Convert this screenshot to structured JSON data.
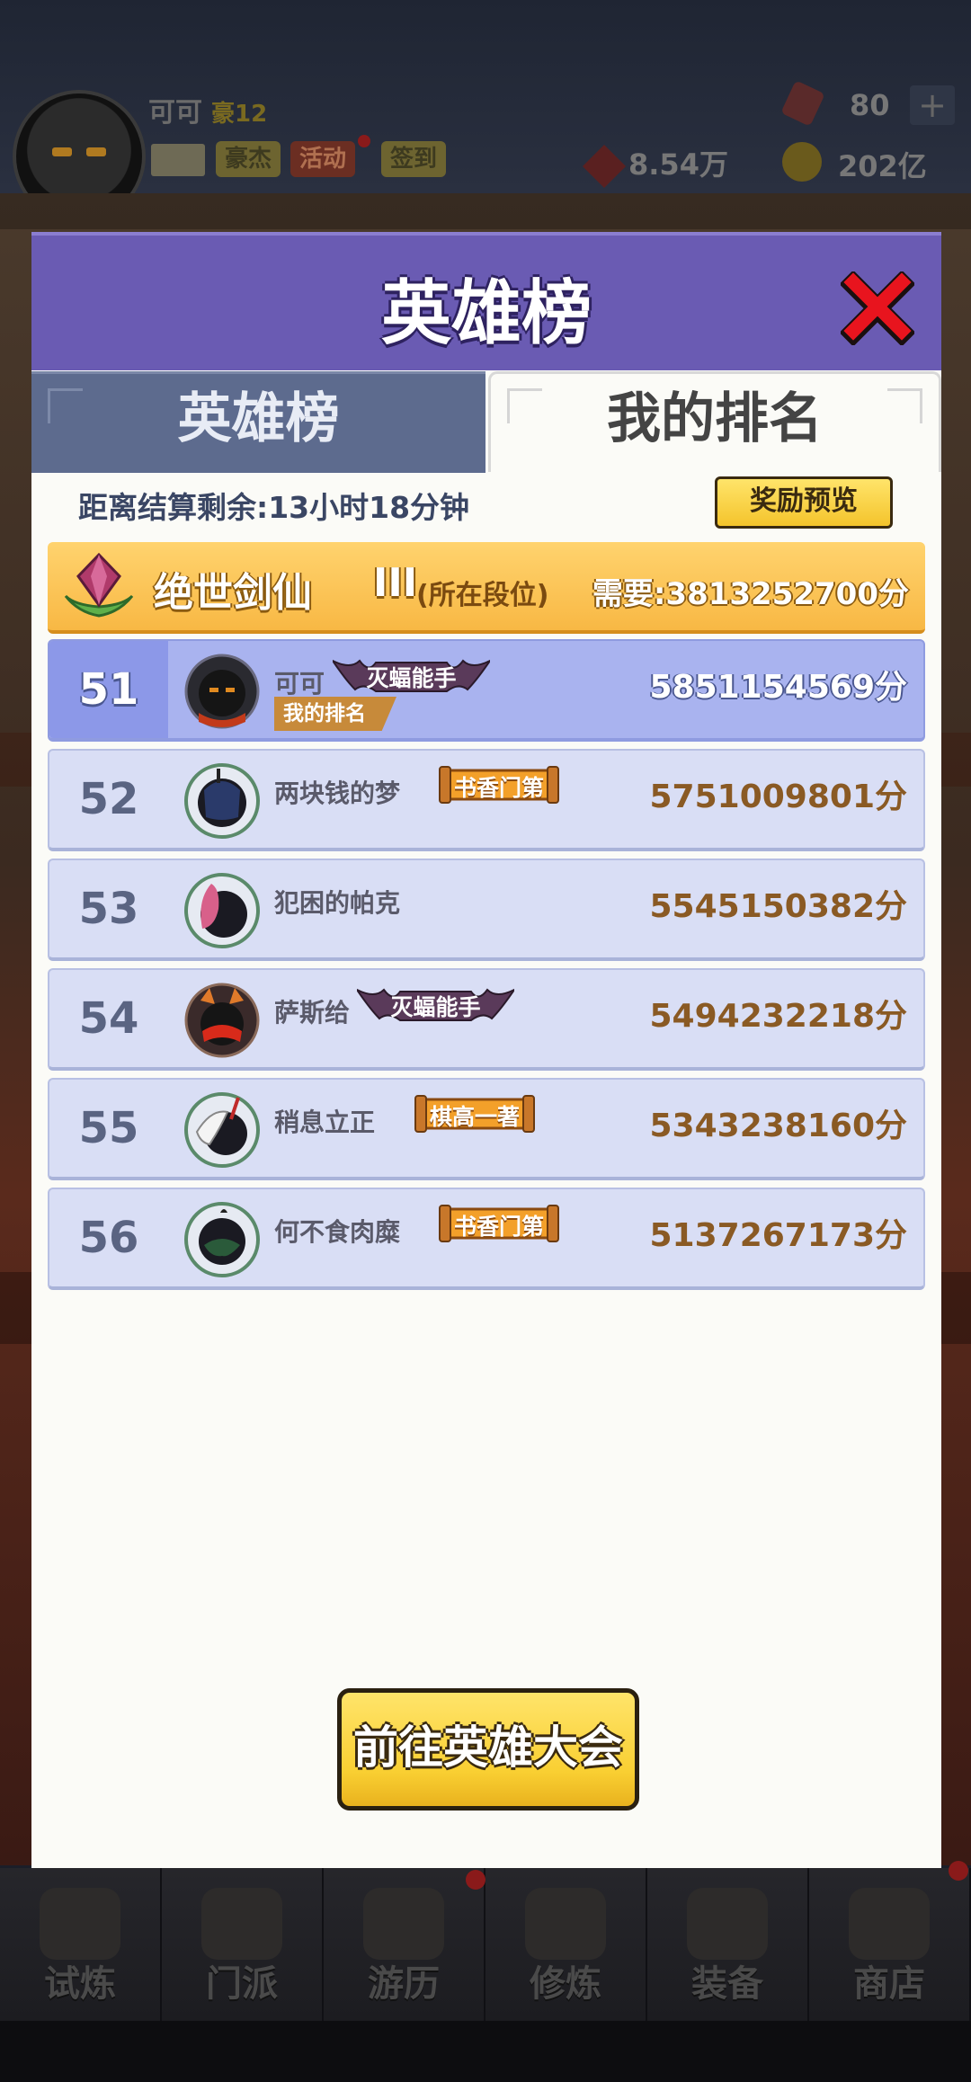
{
  "hud": {
    "player_name": "可可",
    "level": "豪12",
    "buttons": [
      "豪杰",
      "活动",
      "签到"
    ],
    "gems": "80",
    "power": "8.54万",
    "coins": "202亿"
  },
  "dialog": {
    "title": "英雄榜",
    "tabs": {
      "leaderboard": "英雄榜",
      "my_rank": "我的排名"
    },
    "countdown": "距离结算剩余:13小时18分钟",
    "reward_preview": "奖励预览",
    "tier": {
      "name": "绝世剑仙",
      "level": "III",
      "note": "(所在段位)",
      "requirement": "需要:3813252700分"
    },
    "my_rank_tag": "我的排名",
    "goto_button": "前往英雄大会"
  },
  "ranks": [
    {
      "rank": "51",
      "name": "可可",
      "badge": "灭蝠能手",
      "score": "5851154569分",
      "me": true
    },
    {
      "rank": "52",
      "name": "两块钱的梦",
      "badge": "书香门第",
      "score": "5751009801分"
    },
    {
      "rank": "53",
      "name": "犯困的帕克",
      "badge": "",
      "score": "5545150382分"
    },
    {
      "rank": "54",
      "name": "萨斯给",
      "badge": "灭蝠能手",
      "score": "5494232218分"
    },
    {
      "rank": "55",
      "name": "稍息立正",
      "badge": "棋高一著",
      "score": "5343238160分"
    },
    {
      "rank": "56",
      "name": "何不食肉糜",
      "badge": "书香门第",
      "score": "5137267173分"
    }
  ],
  "bottom_nav": [
    "试炼",
    "门派",
    "游历",
    "修炼",
    "装备",
    "商店"
  ],
  "colors": {
    "header": "#6a5bb3",
    "row": "#d9def5",
    "row_me": "#a9b3ef",
    "score": "#8a5a24",
    "button": "#f9cf32"
  }
}
